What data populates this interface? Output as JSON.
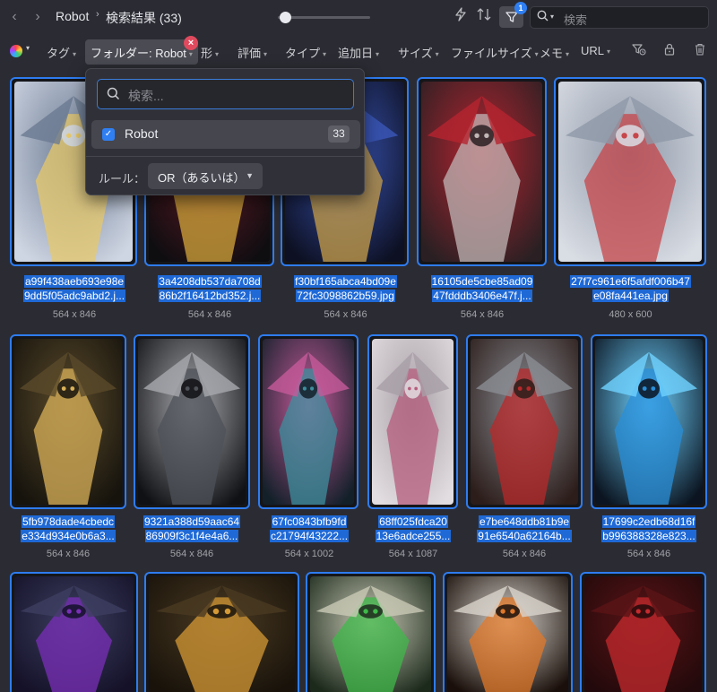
{
  "topbar": {
    "back_icon": "chevron-left-icon",
    "forward_icon": "chevron-right-icon",
    "breadcrumb_parent": "Robot",
    "breadcrumb_separator": "›",
    "breadcrumb_current": "検索結果 (33)",
    "filter_badge": "1",
    "search_placeholder": "検索"
  },
  "filterbar": {
    "items": [
      {
        "label": "タグ"
      },
      {
        "label": "フォルダー: Robot"
      },
      {
        "label": "形"
      },
      {
        "label": "評価"
      },
      {
        "label": "タイプ"
      },
      {
        "label": "追加日"
      },
      {
        "label": "サイズ"
      },
      {
        "label": "ファイルサイズ"
      },
      {
        "label": "メモ"
      },
      {
        "label": "URL"
      }
    ],
    "clear_symbol": "×"
  },
  "folder_popup": {
    "search_placeholder": "検索...",
    "option_label": "Robot",
    "option_count": "33",
    "option_checked": true,
    "rule_label": "ルール：",
    "rule_value": "OR（あるいは）"
  },
  "accent_color": "#2e7cf0",
  "items": [
    {
      "name_line1": "a99f438aeb693e98e",
      "name_line2": "9dd5f05adc9abd2.j...",
      "dims": "564 x 846",
      "palette": [
        "#cfd6e3",
        "#e7c86a",
        "#6b7a92"
      ]
    },
    {
      "name_line1": "3a4208db537da708d",
      "name_line2": "86b2f16412bd352.j...",
      "dims": "564 x 846",
      "palette": [
        "#0e0d10",
        "#d4a53b",
        "#6a1c28"
      ]
    },
    {
      "name_line1": "f30bf165abca4bd09e",
      "name_line2": "72fc3098862b59.jpg",
      "dims": "564 x 846",
      "palette": [
        "#0d1022",
        "#c9a04a",
        "#3b57b9"
      ]
    },
    {
      "name_line1": "16105de5cbe85ad09",
      "name_line2": "47fdddb3406e47f.j...",
      "dims": "564 x 846",
      "palette": [
        "#2a2023",
        "#c0b6b6",
        "#b52430"
      ]
    },
    {
      "name_line1": "27f7c961e6f5afdf006b47",
      "name_line2": "e08fa441ea.jpg",
      "dims": "480 x 600",
      "palette": [
        "#d9dde4",
        "#c6464a",
        "#8f98a8"
      ]
    },
    {
      "name_line1": "5fb978dade4cbedc",
      "name_line2": "e334d934e0b6a3...",
      "dims": "564 x 846",
      "palette": [
        "#16130d",
        "#d9b25a",
        "#5a4a2a"
      ]
    },
    {
      "name_line1": "9321a388d59aac64",
      "name_line2": "86909f3c1f4e4a6...",
      "dims": "564 x 846",
      "palette": [
        "#101114",
        "#4e5158",
        "#a8a9ae"
      ]
    },
    {
      "name_line1": "67fc0843bfb9fd",
      "name_line2": "c21794f43222...",
      "dims": "564 x 1002",
      "palette": [
        "#13202a",
        "#3e8f9e",
        "#c55a9a"
      ]
    },
    {
      "name_line1": "68ff025fdca20",
      "name_line2": "13e6adce255...",
      "dims": "564 x 1087",
      "palette": [
        "#e2dde0",
        "#b55c7c",
        "#a89fa6"
      ]
    },
    {
      "name_line1": "e7be648ddb81b9e",
      "name_line2": "91e6540a62164b...",
      "dims": "564 x 846",
      "palette": [
        "#2c1d1a",
        "#b8282a",
        "#8a8d94"
      ]
    },
    {
      "name_line1": "17699c2edb68d16f",
      "name_line2": "b996388328e823...",
      "dims": "564 x 846",
      "palette": [
        "#0b1420",
        "#2a8fd8",
        "#6fd2ff"
      ]
    },
    {
      "palette": [
        "#141128",
        "#7a2fb8",
        "#3d3f60"
      ]
    },
    {
      "palette": [
        "#18120a",
        "#d59a36",
        "#4a3a22"
      ]
    },
    {
      "palette": [
        "#1c2a1c",
        "#3fb84a",
        "#c9c9b5"
      ]
    },
    {
      "palette": [
        "#1a0f0a",
        "#e0782a",
        "#d8d3cc"
      ]
    },
    {
      "palette": [
        "#22090b",
        "#c42a2e",
        "#5a1416"
      ]
    }
  ]
}
